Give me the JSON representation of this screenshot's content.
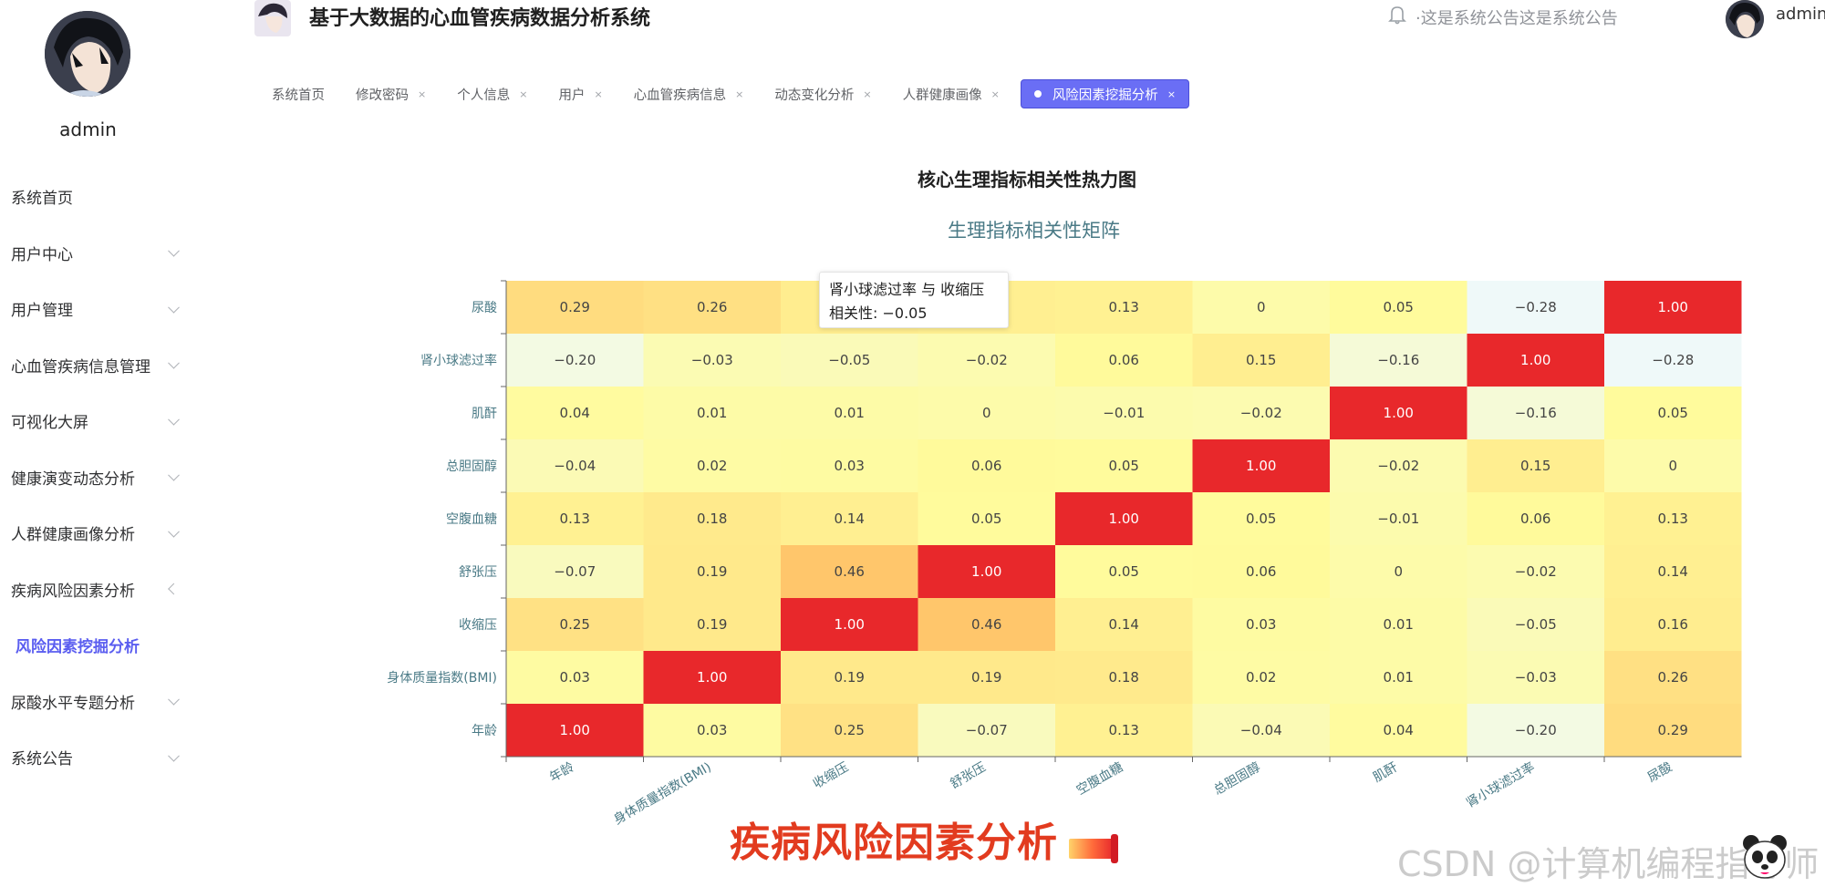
{
  "sidebar": {
    "username": "admin",
    "items": [
      {
        "label": "系统首页",
        "chevron": "none"
      },
      {
        "label": "用户中心",
        "chevron": "down"
      },
      {
        "label": "用户管理",
        "chevron": "down"
      },
      {
        "label": "心血管疾病信息管理",
        "chevron": "down"
      },
      {
        "label": "可视化大屏",
        "chevron": "down"
      },
      {
        "label": "健康演变动态分析",
        "chevron": "down"
      },
      {
        "label": "人群健康画像分析",
        "chevron": "down"
      },
      {
        "label": "疾病风险因素分析",
        "chevron": "left"
      },
      {
        "label": "风险因素挖掘分析",
        "chevron": "none",
        "sub": true
      },
      {
        "label": "尿酸水平专题分析",
        "chevron": "down"
      },
      {
        "label": "系统公告",
        "chevron": "down"
      }
    ]
  },
  "header": {
    "title": "基于大数据的心血管疾病数据分析系统",
    "notice": "·这是系统公告这是系统公告",
    "user": "admin"
  },
  "tabs": [
    {
      "label": "系统首页",
      "closable": false,
      "active": false
    },
    {
      "label": "修改密码",
      "closable": true,
      "active": false
    },
    {
      "label": "个人信息",
      "closable": true,
      "active": false
    },
    {
      "label": "用户",
      "closable": true,
      "active": false
    },
    {
      "label": "心血管疾病信息",
      "closable": true,
      "active": false
    },
    {
      "label": "动态变化分析",
      "closable": true,
      "active": false
    },
    {
      "label": "人群健康画像",
      "closable": true,
      "active": false
    },
    {
      "label": "风险因素挖掘分析",
      "closable": true,
      "active": true
    }
  ],
  "tab_close_glyph": "×",
  "chart_heading": "核心生理指标相关性热力图",
  "chart_data": {
    "type": "heatmap",
    "title": "生理指标相关性矩阵",
    "x_labels": [
      "年龄",
      "身体质量指数(BMI)",
      "收缩压",
      "舒张压",
      "空腹血糖",
      "总胆固醇",
      "肌酐",
      "肾小球滤过率",
      "尿酸"
    ],
    "y_labels": [
      "年龄",
      "身体质量指数(BMI)",
      "收缩压",
      "舒张压",
      "空腹血糖",
      "总胆固醇",
      "肌酐",
      "肾小球滤过率",
      "尿酸"
    ],
    "matrix": [
      [
        1.0,
        0.03,
        0.25,
        -0.07,
        0.13,
        -0.04,
        0.04,
        -0.2,
        0.29
      ],
      [
        0.03,
        1.0,
        0.19,
        0.19,
        0.18,
        0.02,
        0.01,
        -0.03,
        0.26
      ],
      [
        0.25,
        0.19,
        1.0,
        0.46,
        0.14,
        0.03,
        0.01,
        -0.05,
        0.16
      ],
      [
        -0.07,
        0.19,
        0.46,
        1.0,
        0.05,
        0.06,
        0,
        -0.02,
        0.14
      ],
      [
        0.13,
        0.18,
        0.14,
        0.05,
        1.0,
        0.05,
        -0.01,
        0.06,
        0.13
      ],
      [
        -0.04,
        0.02,
        0.03,
        0.06,
        0.05,
        1.0,
        -0.02,
        0.15,
        0
      ],
      [
        0.04,
        0.01,
        0.01,
        0,
        -0.01,
        -0.02,
        1.0,
        -0.16,
        0.05
      ],
      [
        -0.2,
        -0.03,
        -0.05,
        -0.02,
        0.06,
        0.15,
        -0.16,
        1.0,
        -0.28
      ],
      [
        0.29,
        0.26,
        0.16,
        0.14,
        0.13,
        0,
        0.05,
        -0.28,
        1.0
      ]
    ],
    "value_range": [
      -0.3,
      1.0
    ],
    "colors": {
      "low": "#eef9ff",
      "mid": "#fffb9c",
      "high": "#e8282b",
      "label": "#4a7a86"
    }
  },
  "tooltip": {
    "line1": "肾小球滤过率 与 收缩压",
    "line2": "相关性: −0.05"
  },
  "overlay": {
    "caption": "疾病风险因素分析",
    "watermark": "CSDN @计算机编程指导师"
  }
}
